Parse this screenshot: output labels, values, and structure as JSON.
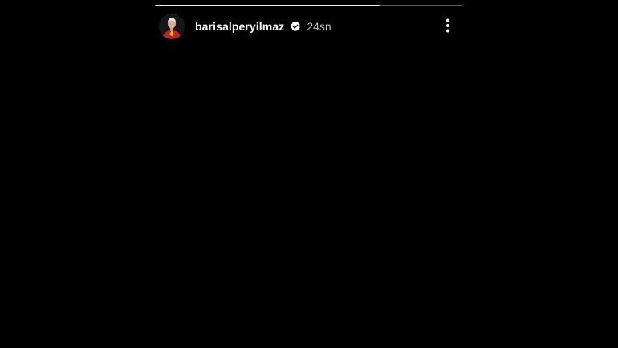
{
  "story": {
    "progress_fraction": 0.73,
    "username": "barisalperyilmaz",
    "timestamp": "24sn",
    "verified": true
  },
  "icons": {
    "verified": "verified-badge-icon",
    "more": "more-vertical-icon",
    "avatar": "profile-avatar"
  },
  "colors": {
    "background": "#000000",
    "progress_fill": "#f2f2f2",
    "progress_track": "#5a5a5a",
    "username_text": "#ffffff",
    "timestamp_text": "#bdbdbd",
    "jersey_red": "#b3262a",
    "jersey_yellow": "#e9b018"
  }
}
